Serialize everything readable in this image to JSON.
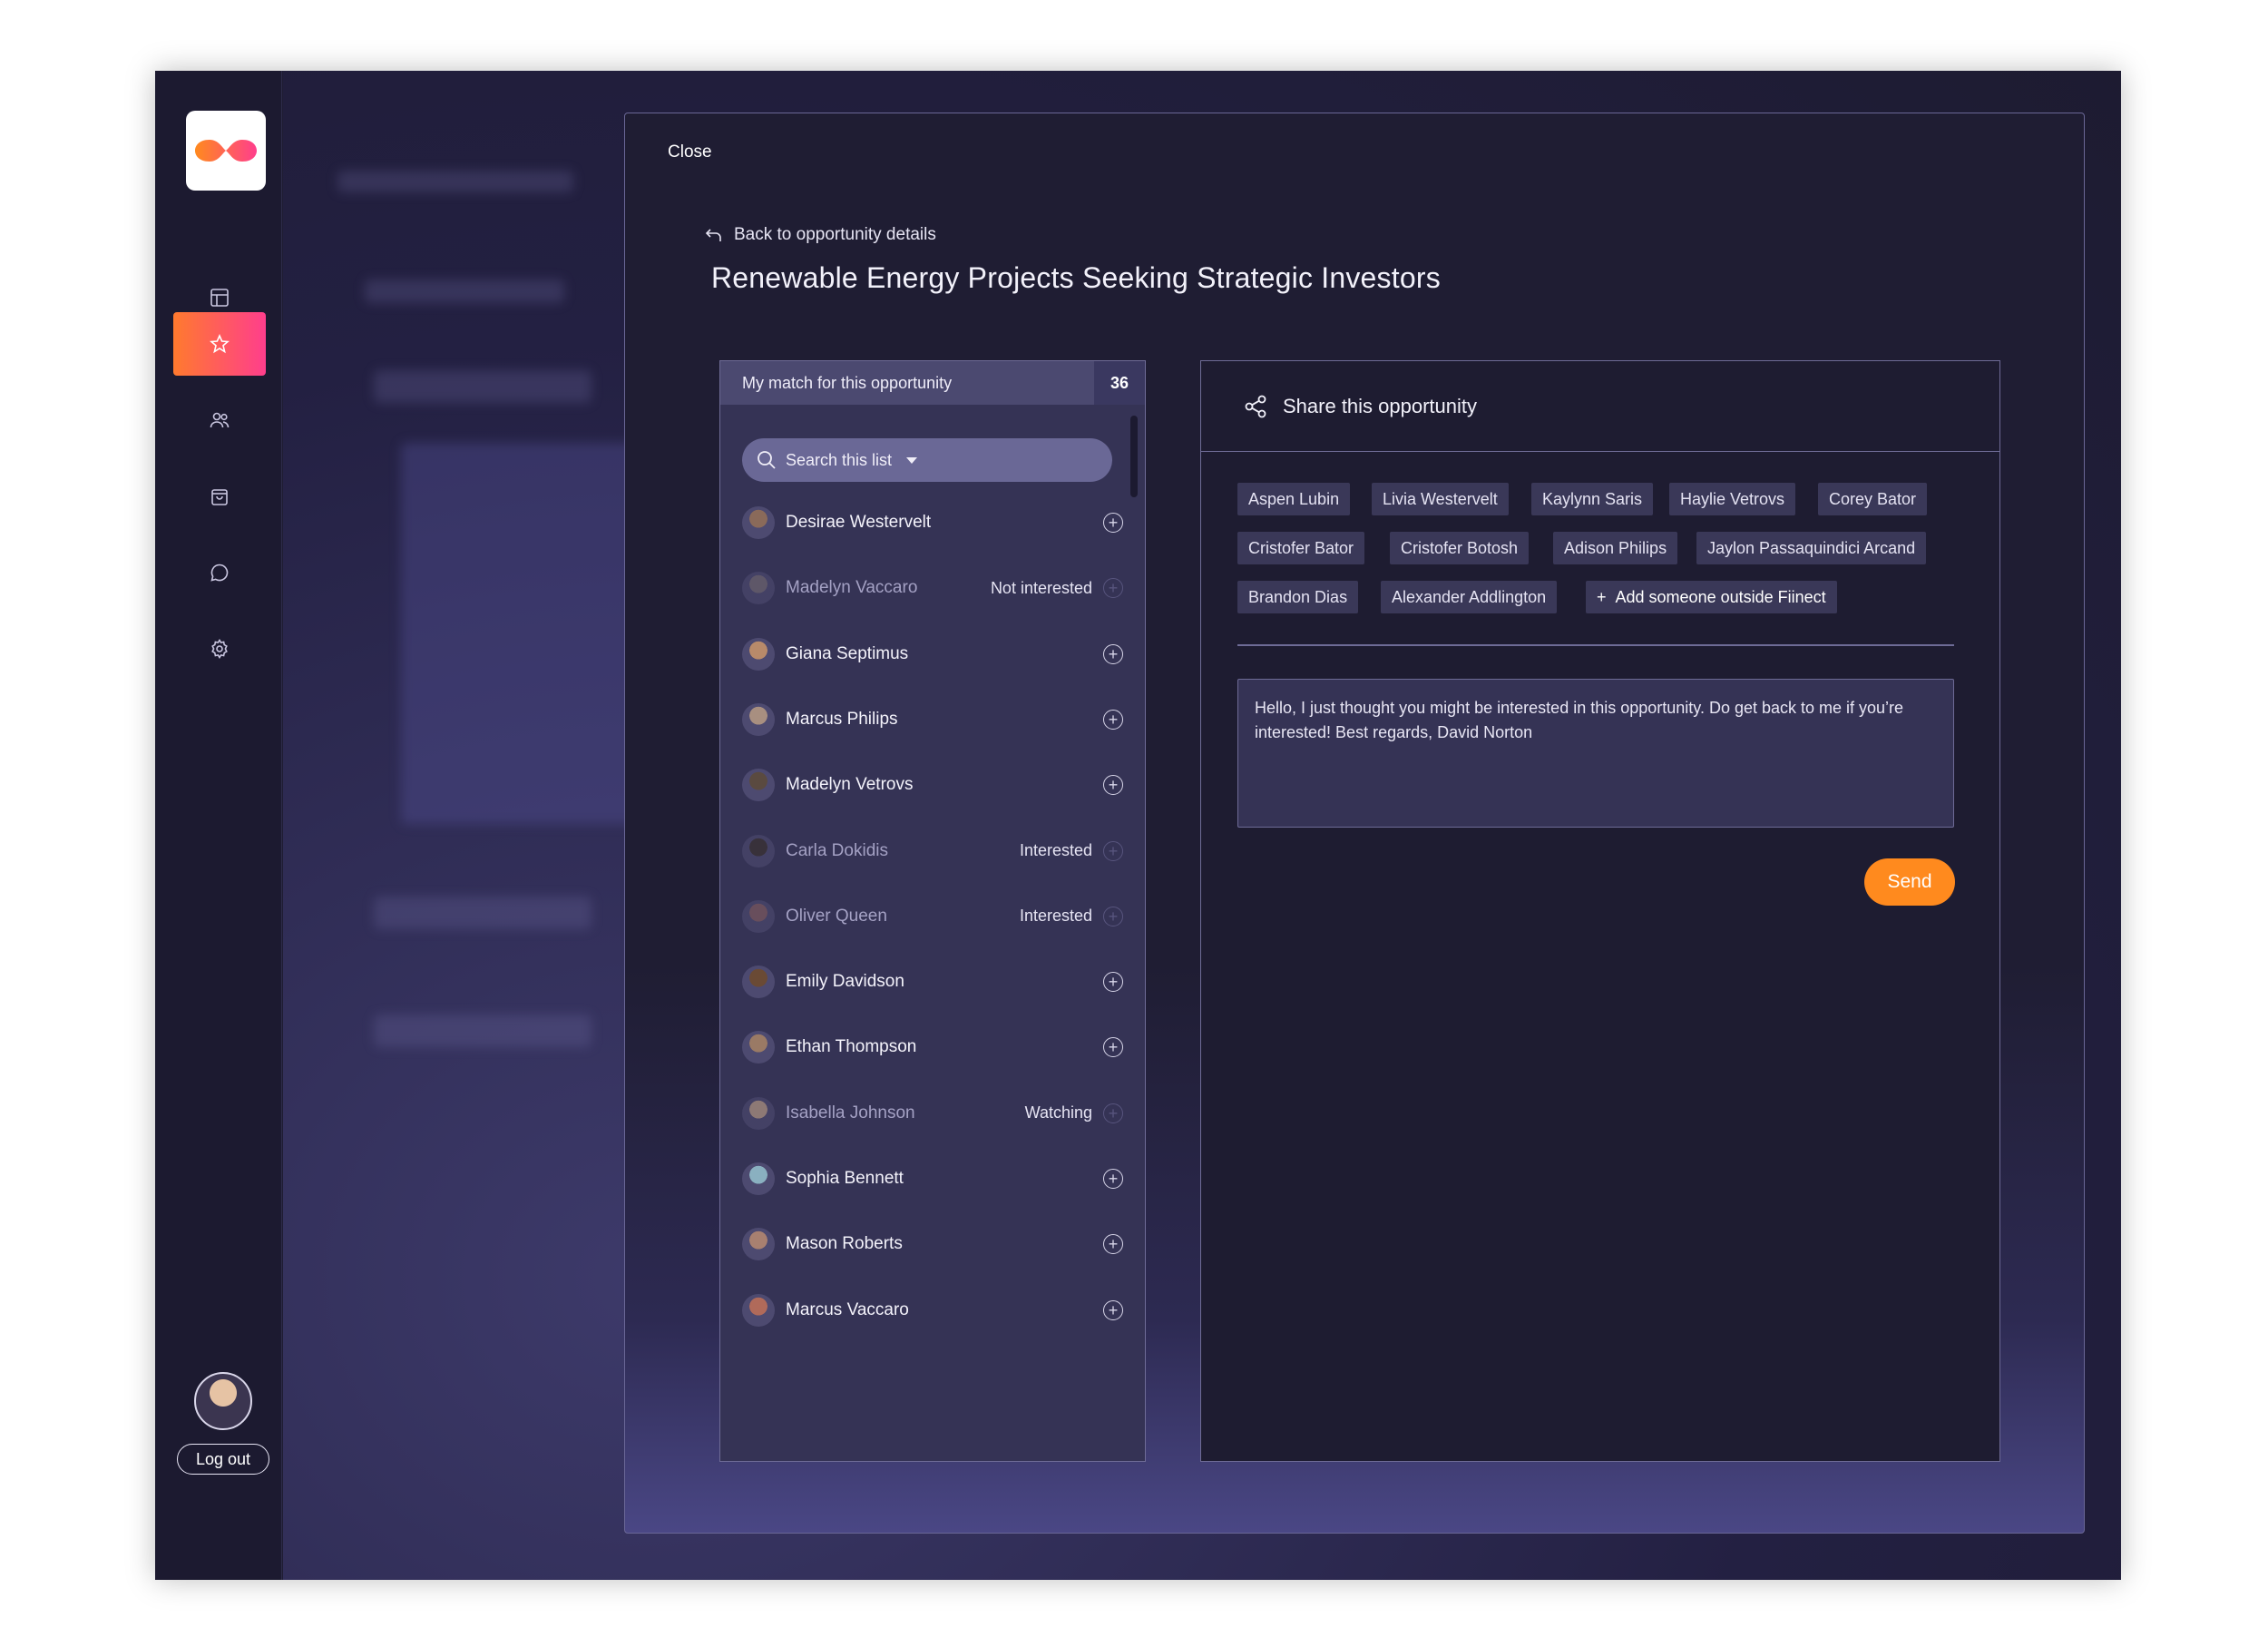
{
  "sidebar": {
    "logout_label": "Log out",
    "nav": [
      {
        "icon": "dashboard-icon"
      },
      {
        "icon": "star-icon",
        "active": true
      },
      {
        "icon": "people-icon"
      },
      {
        "icon": "shopping-bag-icon"
      },
      {
        "icon": "chat-icon"
      },
      {
        "icon": "gear-icon"
      }
    ]
  },
  "modal": {
    "close_label": "Close",
    "back_label": "Back to opportunity details",
    "title": "Renewable Energy Projects Seeking Strategic Investors"
  },
  "match_list": {
    "header_label": "My match for this opportunity",
    "count": "36",
    "search_placeholder": "Search this list",
    "people": [
      {
        "name": "Desirae Westervelt",
        "status": "",
        "dim": false,
        "avatar_color": "#8a6a5a"
      },
      {
        "name": "Madelyn Vaccaro",
        "status": "Not interested",
        "dim": true,
        "avatar_color": "#7a6f75"
      },
      {
        "name": "Giana Septimus",
        "status": "",
        "dim": false,
        "avatar_color": "#b88a6a"
      },
      {
        "name": "Marcus Philips",
        "status": "",
        "dim": false,
        "avatar_color": "#a88f80"
      },
      {
        "name": "Madelyn Vetrovs",
        "status": "",
        "dim": false,
        "avatar_color": "#5a4a40"
      },
      {
        "name": "Carla Dokidis",
        "status": "Interested",
        "dim": true,
        "avatar_color": "#3a3028"
      },
      {
        "name": "Oliver Queen",
        "status": "Interested",
        "dim": true,
        "avatar_color": "#8a6060"
      },
      {
        "name": "Emily Davidson",
        "status": "",
        "dim": false,
        "avatar_color": "#6a4a35"
      },
      {
        "name": "Ethan Thompson",
        "status": "",
        "dim": false,
        "avatar_color": "#9a7a65"
      },
      {
        "name": "Isabella Johnson",
        "status": "Watching",
        "dim": true,
        "avatar_color": "#c8a88a"
      },
      {
        "name": "Sophia Bennett",
        "status": "",
        "dim": false,
        "avatar_color": "#8ab0c0"
      },
      {
        "name": "Mason Roberts",
        "status": "",
        "dim": false,
        "avatar_color": "#a88070"
      },
      {
        "name": "Marcus Vaccaro",
        "status": "",
        "dim": false,
        "avatar_color": "#b06a5a"
      }
    ]
  },
  "share": {
    "heading": "Share this opportunity",
    "recipients": [
      "Aspen Lubin",
      "Livia Westervelt",
      "Kaylynn Saris",
      "Haylie Vetrovs",
      "Corey Bator",
      "Cristofer Bator",
      "Cristofer Botosh",
      "Adison Philips",
      "Jaylon Passaquindici Arcand",
      "Brandon Dias",
      "Alexander Addlington"
    ],
    "add_outside_label": "Add someone outside Fiinect",
    "message": "Hello, I just thought you might be interested in this opportunity. Do get back to me if you’re interested! Best regards, David Norton",
    "send_label": "Send"
  },
  "colors": {
    "accent": "#ff8a1e",
    "active_nav_gradient_start": "#ff7a2e",
    "active_nav_gradient_end": "#ff3e8c",
    "background": "#1e1c33"
  }
}
